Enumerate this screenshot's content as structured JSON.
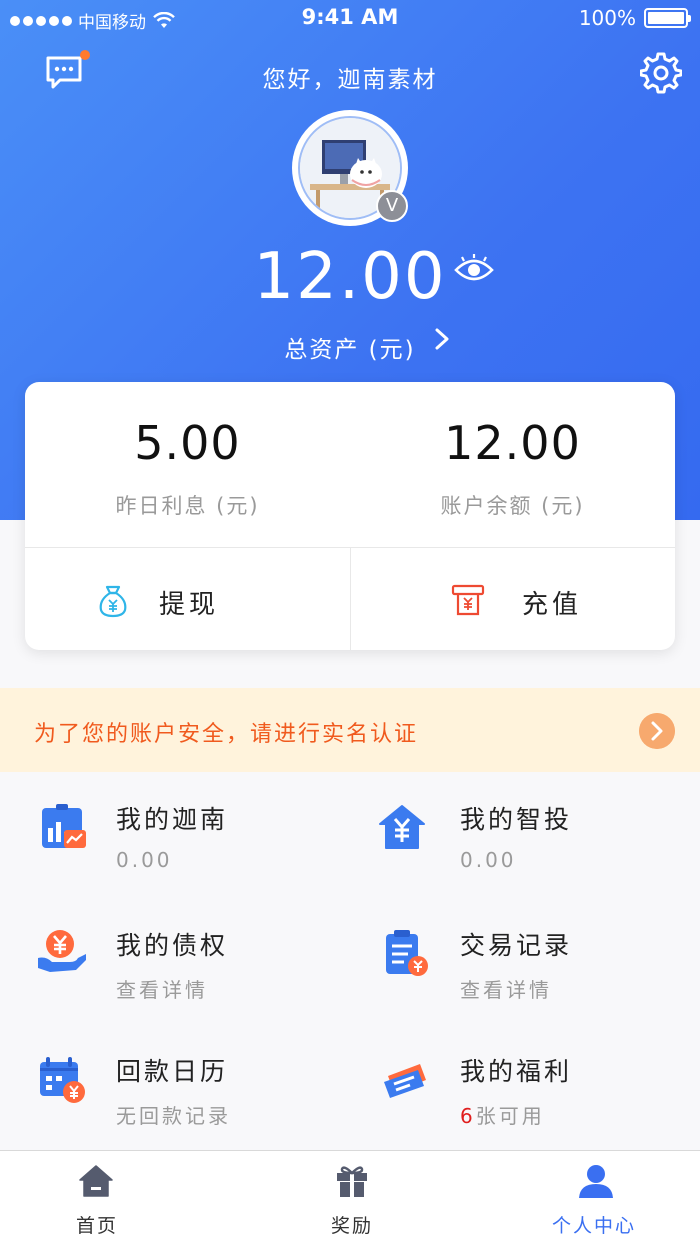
{
  "status_bar": {
    "carrier": "中国移动",
    "time": "9:41 AM",
    "battery": "100%"
  },
  "header": {
    "greeting": "您好，迦南素材",
    "messages_icon": "chat-bubble-icon",
    "settings_icon": "gear-icon",
    "has_unread_message": true
  },
  "profile": {
    "avatar_icon": "avatar-illustration",
    "badge": "V"
  },
  "assets": {
    "total_amount": "12.00",
    "total_label": "总资产 (元)",
    "visibility_icon": "eye-icon"
  },
  "summary_card": {
    "yesterday_interest": {
      "value": "5.00",
      "label": "昨日利息 (元)"
    },
    "account_balance": {
      "value": "12.00",
      "label": "账户余额 (元)"
    },
    "withdraw": {
      "label": "提现",
      "icon": "money-bag-icon"
    },
    "recharge": {
      "label": "充值",
      "icon": "recharge-icon"
    }
  },
  "banner": {
    "text": "为了您的账户安全，请进行实名认证",
    "icon": "chevron-right-circle-icon"
  },
  "menu": {
    "my_jianan": {
      "title": "我的迦南",
      "sub": "0.00",
      "icon": "chart-board-icon"
    },
    "my_smart_invest": {
      "title": "我的智投",
      "sub": "0.00",
      "icon": "yuan-house-icon"
    },
    "my_claims": {
      "title": "我的债权",
      "sub": "查看详情",
      "icon": "yuan-hand-icon"
    },
    "transactions": {
      "title": "交易记录",
      "sub": "查看详情",
      "icon": "clipboard-icon"
    },
    "repayment_calendar": {
      "title": "回款日历",
      "sub": "无回款记录",
      "icon": "calendar-icon"
    },
    "my_benefits": {
      "title": "我的福利",
      "sub_count": "6",
      "sub_text": "张可用",
      "icon": "coupons-icon"
    }
  },
  "tabbar": {
    "home": {
      "label": "首页",
      "icon": "home-icon"
    },
    "rewards": {
      "label": "奖励",
      "icon": "gift-icon"
    },
    "profile": {
      "label": "个人中心",
      "icon": "person-icon"
    },
    "active": "profile"
  },
  "colors": {
    "primary": "#3d73f2",
    "accent_orange": "#f05a1e",
    "banner_bg": "#fff3dc",
    "highlight_red": "#e01e1e"
  }
}
